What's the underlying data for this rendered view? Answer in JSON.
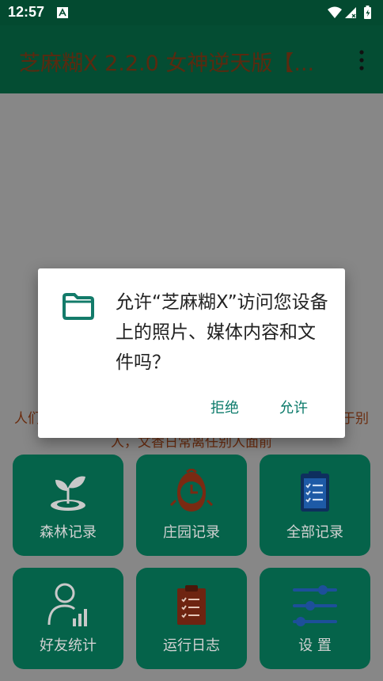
{
  "status": {
    "time": "12:57"
  },
  "appbar": {
    "title": "芝麻糊X 2.2.0 女神逆天版【..."
  },
  "banner": {
    "line1": "人们",
    "line1_right": "于别",
    "line2": "人，文香日常离任别人面前"
  },
  "tiles": [
    {
      "label": "森林记录",
      "icon": "sprout-icon"
    },
    {
      "label": "庄园记录",
      "icon": "chick-icon"
    },
    {
      "label": "全部记录",
      "icon": "clipboard-icon"
    },
    {
      "label": "好友统计",
      "icon": "user-stats-icon"
    },
    {
      "label": "运行日志",
      "icon": "log-icon"
    },
    {
      "label": "设 置",
      "icon": "sliders-icon"
    }
  ],
  "dialog": {
    "message": "允许“芝麻糊X”访问您设备上的照片、媒体内容和文件吗？",
    "deny_label": "拒绝",
    "allow_label": "允许"
  },
  "colors": {
    "accent": "#0b7a6a",
    "statusbar": "#034a30",
    "tile": "#05634a"
  }
}
